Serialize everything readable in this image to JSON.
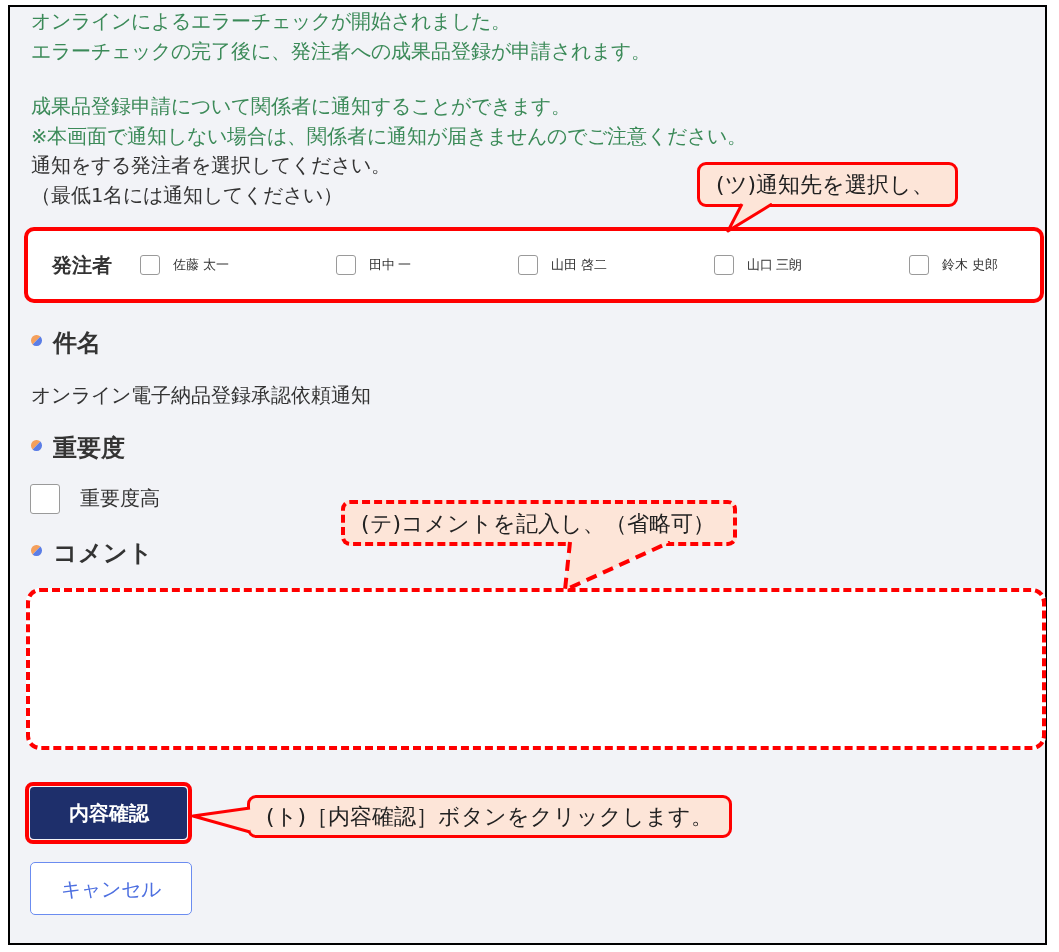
{
  "intro": [
    {
      "lines": [
        {
          "text": "オンラインによるエラーチェックが開始されました。",
          "kind": "notice"
        },
        {
          "text": "エラーチェックの完了後に、発注者への成果品登録が申請されます。",
          "kind": "notice"
        }
      ]
    },
    {
      "lines": [
        {
          "text": "成果品登録申請について関係者に通知することができます。",
          "kind": "notice"
        },
        {
          "text": "※本画面で通知しない場合は、関係者に通知が届きませんのでご注意ください。",
          "kind": "notice"
        },
        {
          "text": "通知をする発注者を選択してください。",
          "kind": "instruction"
        },
        {
          "text": "（最低1名には通知してください）",
          "kind": "instruction"
        }
      ]
    }
  ],
  "recipients": {
    "label": "発注者",
    "options": [
      {
        "name": "佐藤 太一",
        "checked": false
      },
      {
        "name": "田中 一",
        "checked": false
      },
      {
        "name": "山田 啓二",
        "checked": false
      },
      {
        "name": "山口 三朗",
        "checked": false
      },
      {
        "name": "鈴木 史郎",
        "checked": false
      }
    ]
  },
  "subject": {
    "heading": "件名",
    "value": "オンライン電子納品登録承認依頼通知"
  },
  "importance": {
    "heading": "重要度",
    "option": {
      "label": "重要度高",
      "checked": false
    }
  },
  "comment": {
    "heading": "コメント"
  },
  "buttons": [
    {
      "label": "内容確認",
      "kind": "primary"
    },
    {
      "label": "キャンセル",
      "kind": "secondary"
    }
  ],
  "annotations": [
    "(ツ)通知先を選択し、",
    "(テ)コメントを記入し、（省略可）",
    "(ト)［内容確認］ボタンをクリックします。"
  ]
}
